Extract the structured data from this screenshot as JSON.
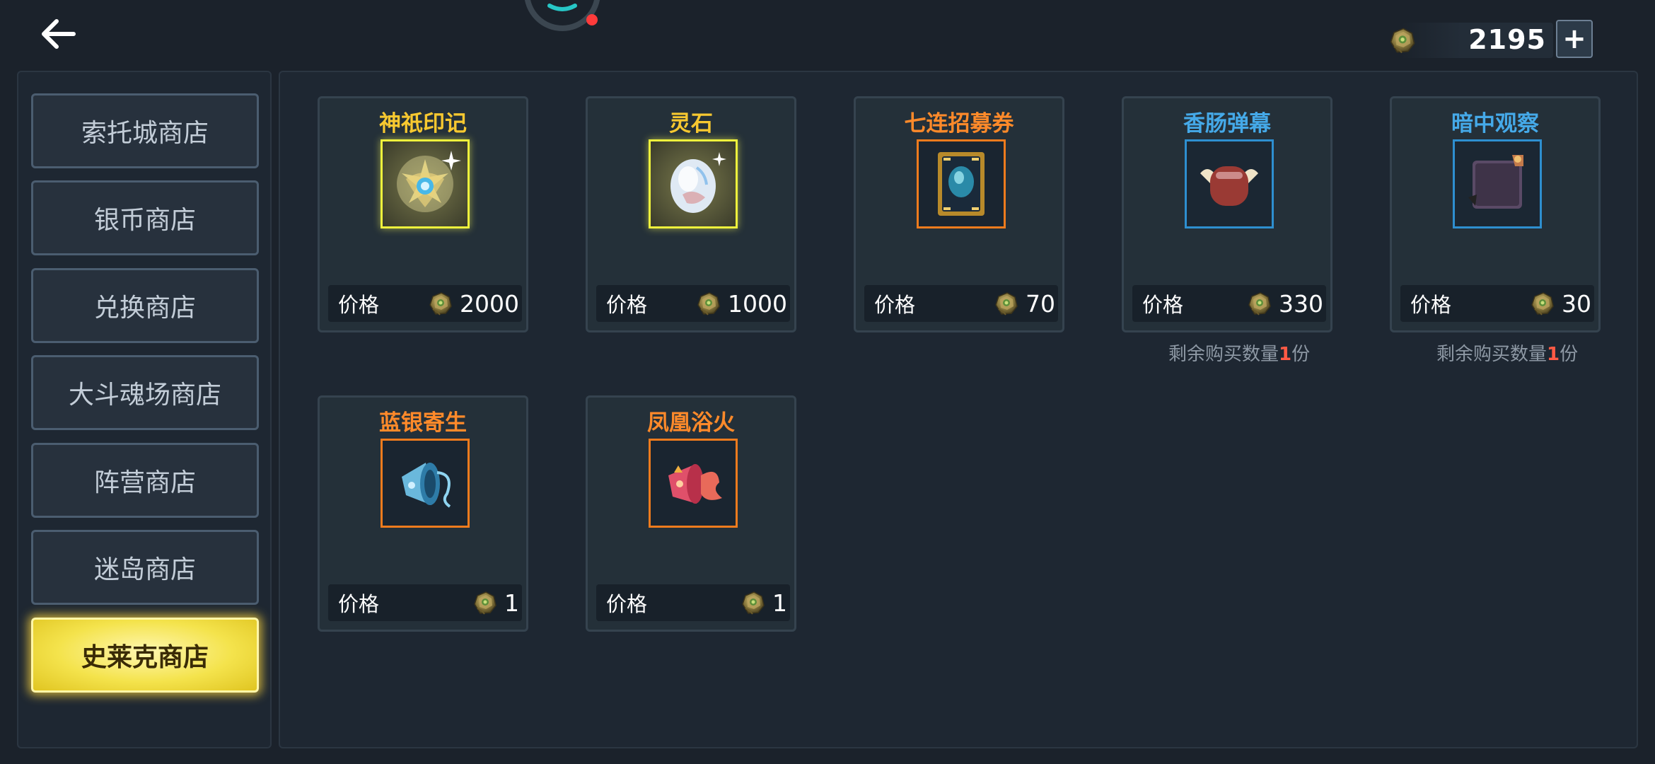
{
  "header": {
    "back_icon": "arrow-left-icon",
    "currency": {
      "icon": "coin-icon",
      "amount": "2195",
      "plus_label": "+"
    }
  },
  "sidebar": {
    "items": [
      {
        "label": "索托城商店",
        "active": false
      },
      {
        "label": "银币商店",
        "active": false
      },
      {
        "label": "兑换商店",
        "active": false
      },
      {
        "label": "大斗魂场商店",
        "active": false
      },
      {
        "label": "阵营商店",
        "active": false
      },
      {
        "label": "迷岛商店",
        "active": false
      },
      {
        "label": "史莱克商店",
        "active": true
      }
    ]
  },
  "shop": {
    "items": [
      {
        "name": "神祇印记",
        "rarity_color": "#f7c830",
        "icon": "divine-mark-icon",
        "price_label": "价格",
        "price": "2000"
      },
      {
        "name": "灵石",
        "rarity_color": "#f7c830",
        "icon": "spirit-stone-icon",
        "price_label": "价格",
        "price": "1000"
      },
      {
        "name": "七连招募券",
        "rarity_color": "#ff8a2a",
        "icon": "recruit-ticket-icon",
        "price_label": "价格",
        "price": "70"
      },
      {
        "name": "香肠弹幕",
        "rarity_color": "#45a9e8",
        "icon": "sausage-barrage-icon",
        "price_label": "价格",
        "price": "330",
        "remain_prefix": "剩余购买数量",
        "remain_num": "1",
        "remain_suffix": "份"
      },
      {
        "name": "暗中观察",
        "rarity_color": "#45a9e8",
        "icon": "secret-observe-icon",
        "price_label": "价格",
        "price": "30",
        "remain_prefix": "剩余购买数量",
        "remain_num": "1",
        "remain_suffix": "份"
      },
      {
        "name": "蓝银寄生",
        "rarity_color": "#ff8a2a",
        "icon": "blue-silver-horn-icon",
        "price_label": "价格",
        "price": "1"
      },
      {
        "name": "凤凰浴火",
        "rarity_color": "#ff8a2a",
        "icon": "phoenix-horn-icon",
        "price_label": "价格",
        "price": "1"
      }
    ]
  }
}
